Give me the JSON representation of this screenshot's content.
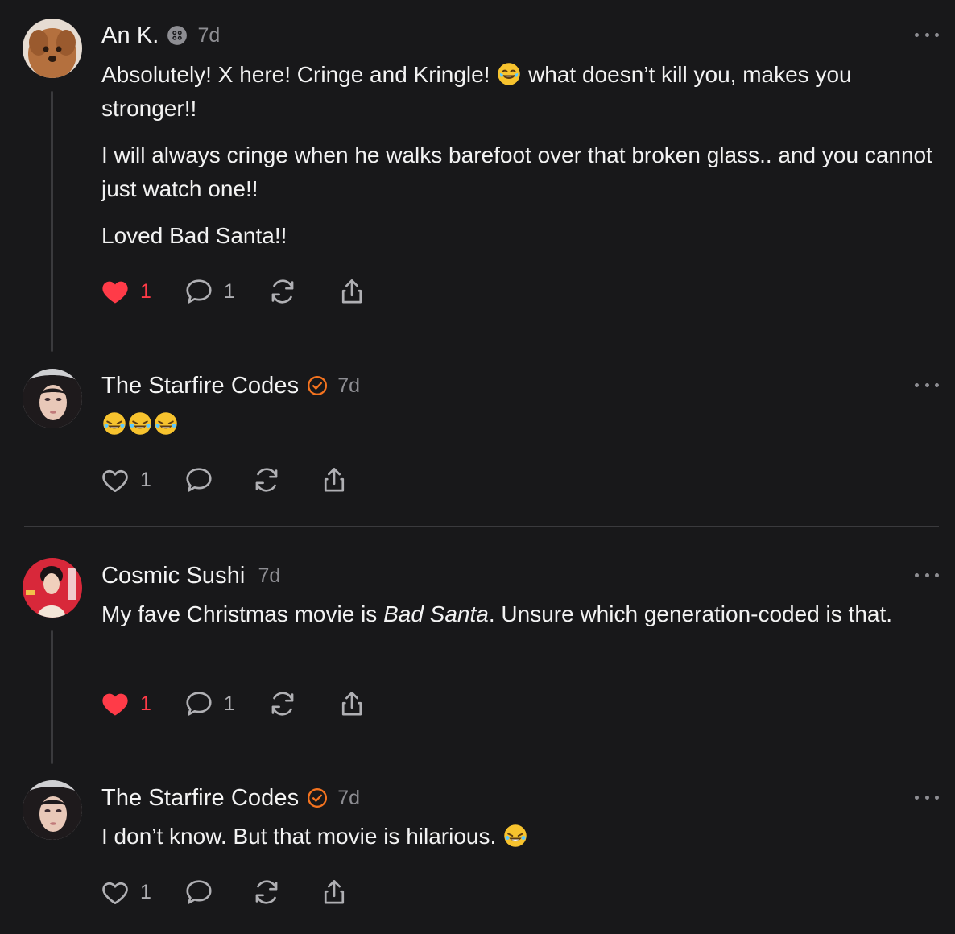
{
  "posts": [
    {
      "author": "An K.",
      "time": "7d",
      "avatar": "dog-avatar",
      "badge": "app-badge-icon",
      "paragraphs": [
        "Absolutely! X here! Cringe and Kringle! 😂 what doesn’t kill you, makes you stronger!!",
        "I will always cringe when he walks barefoot over that broken glass.. and you cannot just watch one!!",
        "Loved Bad Santa!!"
      ],
      "likes": "1",
      "liked": true,
      "replies": "1"
    },
    {
      "author": "The Starfire Codes",
      "time": "7d",
      "avatar": "woman-avatar",
      "badge": "verified-icon",
      "paragraphs": [
        "🤣🤣🤣"
      ],
      "likes": "1",
      "liked": false,
      "replies": ""
    },
    {
      "author": "Cosmic Sushi",
      "time": "7d",
      "avatar": "woman-red-poster-avatar",
      "paragraph_parts": [
        "My fave Christmas movie is ",
        "Bad Santa",
        ". Unsure which generation-coded is that."
      ],
      "likes": "1",
      "liked": true,
      "replies": "1"
    },
    {
      "author": "The Starfire Codes",
      "time": "7d",
      "avatar": "woman-avatar",
      "badge": "verified-icon",
      "paragraphs": [
        "I don’t know. But that movie is hilarious. 🤣"
      ],
      "likes": "1",
      "liked": false,
      "replies": ""
    }
  ],
  "colors": {
    "background": "#18181a",
    "like_red": "#ff3b48",
    "verified_orange": "#f4731f",
    "muted": "#8e8e93"
  }
}
